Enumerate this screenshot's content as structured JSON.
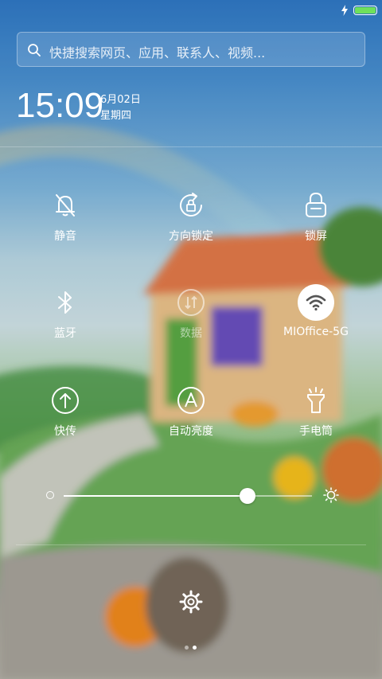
{
  "search": {
    "placeholder": "快捷搜索网页、应用、联系人、视频..."
  },
  "clock": {
    "time": "15:09",
    "date": "6月02日",
    "weekday": "星期四"
  },
  "status": {
    "battery_color": "#6fe05b",
    "battery_level": 1.0
  },
  "toggles": [
    {
      "id": "mute",
      "label": "静音",
      "icon": "bell-slash-icon",
      "active": false
    },
    {
      "id": "rotation",
      "label": "方向锁定",
      "icon": "rotation-lock-icon",
      "active": false
    },
    {
      "id": "lock",
      "label": "锁屏",
      "icon": "lock-icon",
      "active": false
    },
    {
      "id": "bluetooth",
      "label": "蓝牙",
      "icon": "bluetooth-icon",
      "active": false
    },
    {
      "id": "data",
      "label": "数据",
      "icon": "mobile-data-icon",
      "active": false,
      "disabled": true
    },
    {
      "id": "wifi",
      "label": "MIOffice-5G",
      "icon": "wifi-icon",
      "active": true
    },
    {
      "id": "share",
      "label": "快传",
      "icon": "upload-icon",
      "active": false
    },
    {
      "id": "auto_brightness",
      "label": "自动亮度",
      "icon": "auto-brightness-icon",
      "active": false
    },
    {
      "id": "flashlight",
      "label": "手电筒",
      "icon": "flashlight-icon",
      "active": false
    }
  ],
  "brightness": {
    "level": 0.74
  },
  "pager": {
    "pages": 2,
    "current": 2
  }
}
